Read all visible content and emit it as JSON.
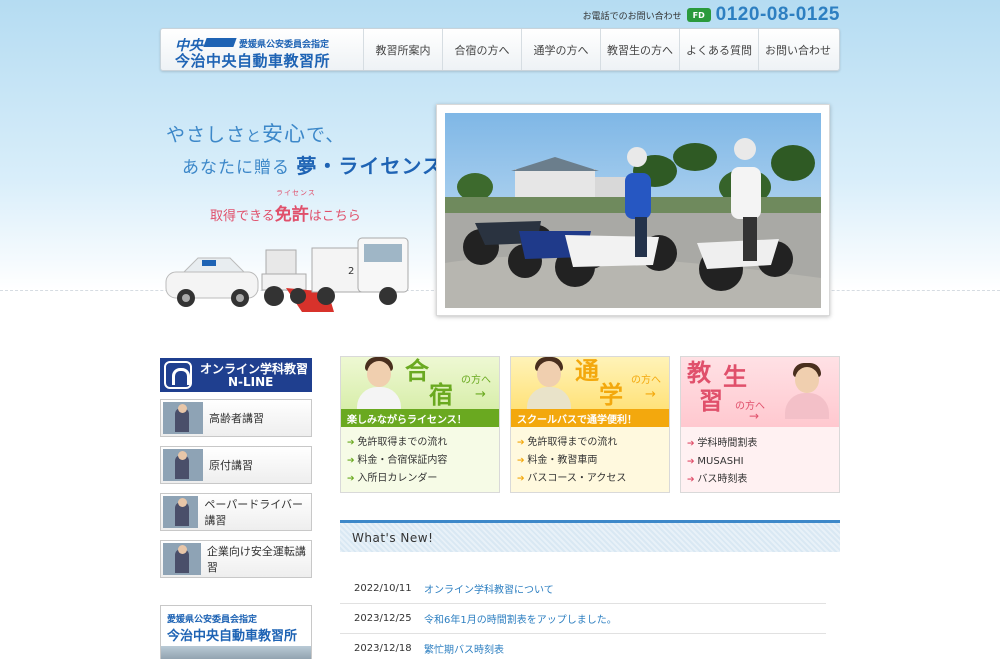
{
  "header": {
    "phone_label": "お電話でのお問い合わせ",
    "freedial_badge": "FD",
    "phone_number": "0120-08-0125",
    "logo_mark": "中央",
    "logo_sub": "愛媛県公安委員会指定",
    "logo_name": "今治中央自動車教習所",
    "nav": [
      {
        "label": "教習所案内"
      },
      {
        "label": "合宿の方へ"
      },
      {
        "label": "通学の方へ"
      },
      {
        "label": "教習生の方へ"
      },
      {
        "label": "よくある質問"
      },
      {
        "label": "お問い合わせ"
      }
    ]
  },
  "hero": {
    "tagline1_a": "やさしさ",
    "tagline1_b": "と",
    "tagline1_c": "安心",
    "tagline1_d": "で、",
    "tagline2_a": "あなたに贈る ",
    "tagline2_b": "夢・ライセンス",
    "cta_a": "取得できる",
    "cta_b": "免許",
    "cta_c": "はこちら",
    "cta_ruby": "ライセンス"
  },
  "sidebar": {
    "nline_title": "オンライン学科教習",
    "nline_sub": "N-LINE",
    "buttons": [
      {
        "label": "高齢者講習"
      },
      {
        "label": "原付講習"
      },
      {
        "label": "ペーパードライバー講習"
      },
      {
        "label": "企業向け安全運転講習"
      }
    ],
    "banner_sub": "愛媛県公安委員会指定",
    "banner_name": "今治中央自動車教習所"
  },
  "cards": [
    {
      "title_a": "合",
      "title_b": "宿",
      "suffix": "の方へ",
      "band": "楽しみながらライセンス！",
      "items": [
        "免許取得までの流れ",
        "料金・合宿保証内容",
        "入所日カレンダー"
      ]
    },
    {
      "title_a": "通",
      "title_b": "学",
      "suffix": "の方へ",
      "band": "スクールバスで通学便利！",
      "items": [
        "免許取得までの流れ",
        "料金・教習車両",
        "バスコース・アクセス"
      ]
    },
    {
      "title_a": "教",
      "title_b": "習",
      "title_c": "生",
      "suffix": "の方へ",
      "items": [
        "学科時間割表",
        "MUSASHI",
        "バス時刻表"
      ]
    }
  ],
  "news": {
    "heading": "What's New!",
    "items": [
      {
        "date": "2022/10/11",
        "title": "オンライン学科教習について"
      },
      {
        "date": "2023/12/25",
        "title": "令和6年1月の時間割表をアップしました。"
      },
      {
        "date": "2023/12/18",
        "title": "繁忙期バス時刻表"
      }
    ]
  },
  "colors": {
    "brand_blue": "#1e63b4",
    "link_blue": "#2d7fc1",
    "card_green": "#6aa920",
    "card_orange": "#f3a80d",
    "card_pink": "#e0506b"
  }
}
